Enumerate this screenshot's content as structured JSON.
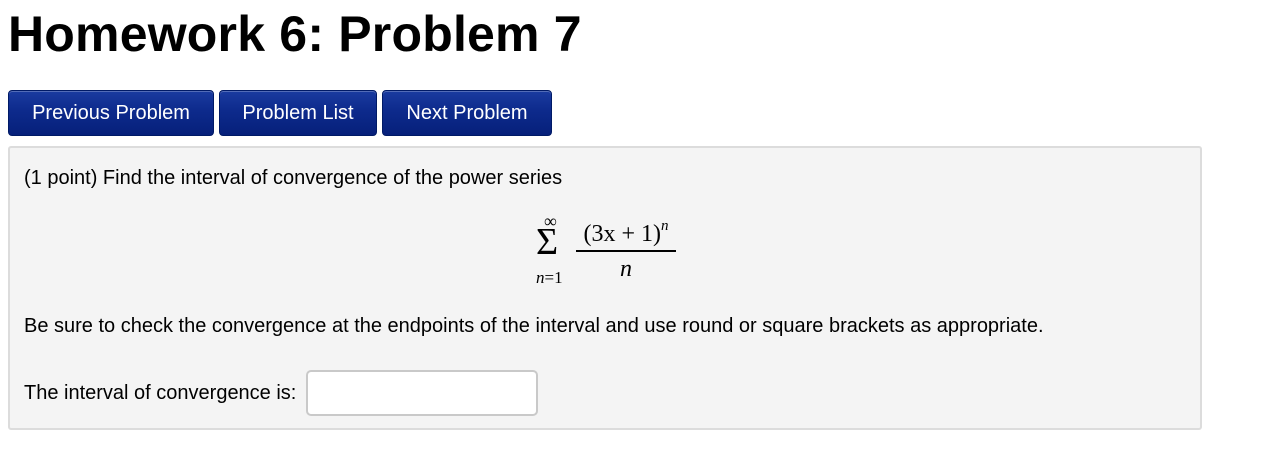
{
  "page": {
    "title": "Homework 6: Problem 7"
  },
  "nav": {
    "previous_label": "Previous Problem",
    "list_label": "Problem List",
    "next_label": "Next Problem"
  },
  "problem": {
    "prompt": "(1 point) Find the interval of convergence of the power series",
    "math": {
      "upper_limit": "∞",
      "sum_symbol": "Σ",
      "lower_limit_var": "n",
      "lower_limit_eq": "=1",
      "numerator": "(3x + 1)",
      "numerator_exponent": "n",
      "denominator": "n"
    },
    "instructions": "Be sure to check the convergence at the endpoints of the interval and use round or square brackets as appropriate.",
    "answer_label": "The interval of convergence is:",
    "answer_value": "",
    "answer_placeholder": ""
  }
}
